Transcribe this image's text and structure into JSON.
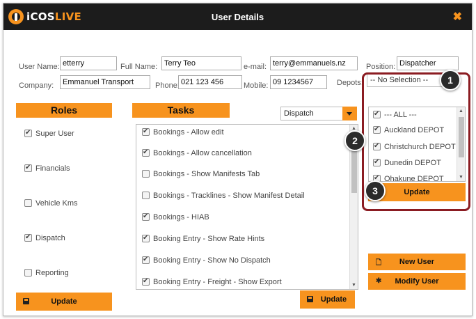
{
  "window": {
    "brand_part1": "iCOS",
    "brand_part2": "LIVE",
    "title": "User Details",
    "close_glyph": "✖"
  },
  "form": {
    "username_label": "User Name:",
    "username_value": "etterry",
    "fullname_label": "Full Name:",
    "fullname_value": "Terry Teo",
    "email_label": "e-mail:",
    "email_value": "terry@emmanuels.nz",
    "position_label": "Position:",
    "position_value": "Dispatcher",
    "company_label": "Company:",
    "company_value": "Emmanuel Transport",
    "phone_label": "Phone:",
    "phone_value": "021 123 456",
    "mobile_label": "Mobile:",
    "mobile_value": "09 1234567",
    "depots_label": "Depots:",
    "depots_value": "-- No Selection --"
  },
  "roles": {
    "heading": "Roles",
    "items": [
      {
        "label": "Super User",
        "checked": true
      },
      {
        "label": "Financials",
        "checked": true
      },
      {
        "label": "Vehicle Kms",
        "checked": false
      },
      {
        "label": "Dispatch",
        "checked": true
      },
      {
        "label": "Reporting",
        "checked": false
      }
    ],
    "update_label": "Update"
  },
  "tasks": {
    "heading": "Tasks",
    "filter_value": "Dispatch",
    "items": [
      {
        "label": "Bookings - Allow edit",
        "checked": true
      },
      {
        "label": "Bookings - Allow cancellation",
        "checked": true
      },
      {
        "label": "Bookings - Show Manifests Tab",
        "checked": false
      },
      {
        "label": "Bookings - Tracklines - Show Manifest Detail",
        "checked": false
      },
      {
        "label": "Bookings - HIAB",
        "checked": true
      },
      {
        "label": "Booking Entry - Show Rate Hints",
        "checked": true
      },
      {
        "label": "Booking Entry - Show No Dispatch",
        "checked": true
      },
      {
        "label": "Booking Entry - Freight - Show Export",
        "checked": true
      }
    ],
    "update_label": "Update"
  },
  "depots": {
    "items": [
      {
        "label": "--- ALL ---",
        "checked": true
      },
      {
        "label": "Auckland DEPOT",
        "checked": true
      },
      {
        "label": "Christchurch DEPOT",
        "checked": true
      },
      {
        "label": "Dunedin DEPOT",
        "checked": true
      },
      {
        "label": "Ohakune DEPOT",
        "checked": true
      }
    ],
    "update_label": "Update"
  },
  "actions": {
    "new_user_label": "New User",
    "modify_user_label": "Modify User"
  },
  "markers": [
    "1",
    "2",
    "3"
  ],
  "colors": {
    "accent": "#f7931e",
    "titlebar": "#1c1c1c",
    "callout": "#8b1c22"
  }
}
